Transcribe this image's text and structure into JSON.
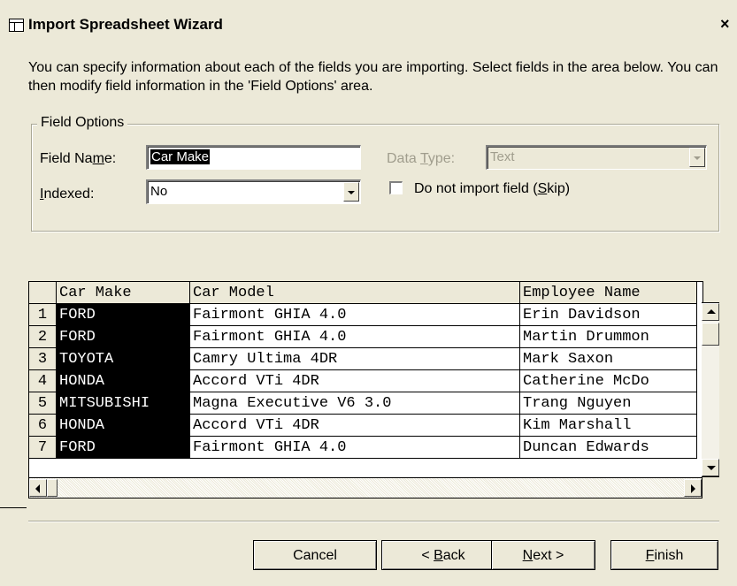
{
  "window": {
    "title": "Import Spreadsheet Wizard",
    "close_glyph": "×"
  },
  "intro": "You can specify information about each of the fields you are importing.  Select fields in the area below. You can then modify field information in the 'Field Options' area.",
  "field_options": {
    "legend": "Field Options",
    "field_name_label_pre": "Field Na",
    "field_name_label_u": "m",
    "field_name_label_post": "e:",
    "field_name_value": "Car Make",
    "data_type_label_pre": "Data ",
    "data_type_label_u": "T",
    "data_type_label_post": "ype:",
    "data_type_value": "Text",
    "indexed_label_u": "I",
    "indexed_label_post": "ndexed:",
    "indexed_value": "No",
    "skip_label_pre": "Do not import field (",
    "skip_label_u": "S",
    "skip_label_post": "kip)",
    "skip_checked": false
  },
  "grid": {
    "headers": [
      "Car Make",
      "Car Model",
      "Employee Name"
    ],
    "rows": [
      {
        "n": "1",
        "make": "FORD",
        "model": "Fairmont GHIA 4.0",
        "employee": "Erin Davidson"
      },
      {
        "n": "2",
        "make": "FORD",
        "model": "Fairmont GHIA 4.0",
        "employee": "Martin Drummon"
      },
      {
        "n": "3",
        "make": "TOYOTA",
        "model": "Camry Ultima 4DR",
        "employee": "Mark Saxon"
      },
      {
        "n": "4",
        "make": "HONDA",
        "model": "Accord VTi 4DR",
        "employee": "Catherine McDo"
      },
      {
        "n": "5",
        "make": "MITSUBISHI",
        "model": "Magna Executive V6 3.0",
        "employee": "Trang Nguyen"
      },
      {
        "n": "6",
        "make": "HONDA",
        "model": "Accord VTi 4DR",
        "employee": "Kim Marshall"
      },
      {
        "n": "7",
        "make": "FORD",
        "model": "Fairmont GHIA 4.0",
        "employee": "Duncan Edwards"
      }
    ]
  },
  "buttons": {
    "cancel": "Cancel",
    "back_pre": "< ",
    "back_u": "B",
    "back_post": "ack",
    "next_u": "N",
    "next_post": "ext >",
    "finish_u": "F",
    "finish_post": "inish"
  },
  "icons": {
    "title": "table-icon",
    "close": "close-icon"
  }
}
